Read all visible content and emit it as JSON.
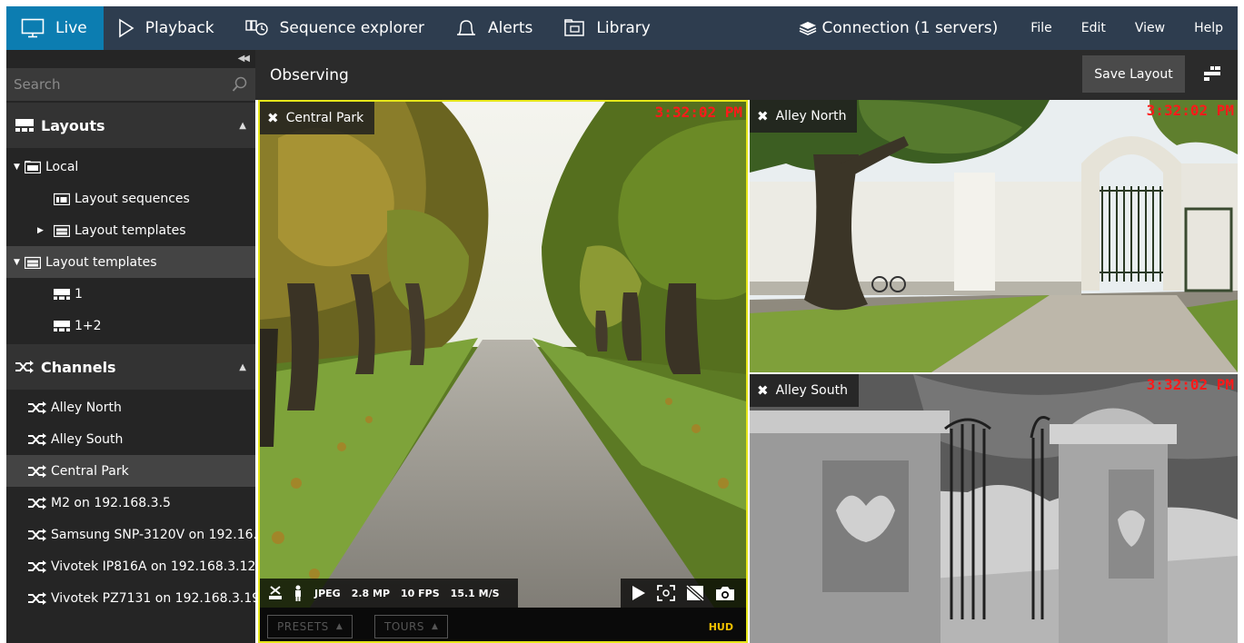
{
  "nav": {
    "tabs": [
      {
        "label": "Live",
        "icon": "monitor-icon",
        "active": true
      },
      {
        "label": "Playback",
        "icon": "play-outline-icon"
      },
      {
        "label": "Sequence explorer",
        "icon": "sequence-icon"
      },
      {
        "label": "Alerts",
        "icon": "bell-icon"
      },
      {
        "label": "Library",
        "icon": "library-icon"
      }
    ],
    "connection": "Connection (1 servers)",
    "menu": [
      "File",
      "Edit",
      "View",
      "Help"
    ]
  },
  "sidebar": {
    "search_placeholder": "Search",
    "layouts_title": "Layouts",
    "layout_tree": [
      {
        "label": "Local"
      },
      {
        "label": "Layout sequences"
      },
      {
        "label": "Layout templates"
      },
      {
        "label": "Layout templates"
      },
      {
        "label": "1"
      },
      {
        "label": "1+2"
      }
    ],
    "channels_title": "Channels",
    "channels": [
      {
        "label": "Alley North"
      },
      {
        "label": "Alley South"
      },
      {
        "label": "Central Park",
        "selected": true
      },
      {
        "label": "M2 on 192.168.3.5"
      },
      {
        "label": "Samsung SNP-3120V on 192.16..."
      },
      {
        "label": "Vivotek IP816A on 192.168.3.12"
      },
      {
        "label": "Vivotek PZ7131 on 192.168.3.19"
      }
    ]
  },
  "main": {
    "title": "Observing",
    "save_layout": "Save Layout"
  },
  "tiles": {
    "central": {
      "name": "Central Park",
      "time": "3:32:02 PM"
    },
    "north": {
      "name": "Alley North",
      "time": "3:32:02 PM"
    },
    "south": {
      "name": "Alley South",
      "time": "3:32:02 PM"
    }
  },
  "stream": {
    "codec": "JPEG",
    "resolution": "2.8 MP",
    "fps": "10 FPS",
    "bitrate": "15.1 M/S"
  },
  "bottom": {
    "presets": "PRESETS",
    "tours": "TOURS",
    "hud": "HUD"
  },
  "colors": {
    "topbar": "#2e3d4f",
    "active_tab": "#0c7db1",
    "selected_tile_border": "#e6e61a",
    "timestamp": "#ff1a1a"
  }
}
